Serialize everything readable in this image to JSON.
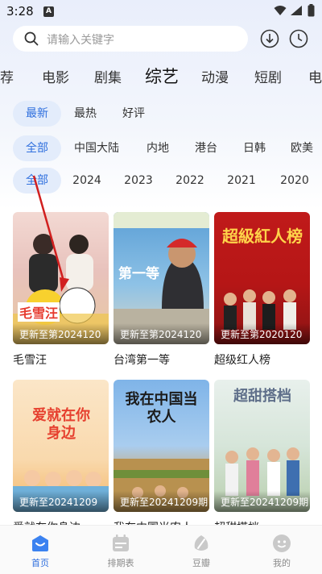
{
  "status_bar": {
    "time": "3:28",
    "badge": "A"
  },
  "search": {
    "placeholder": "请输入关键字"
  },
  "category_tabs": [
    "荐",
    "电影",
    "剧集",
    "综艺",
    "动漫",
    "短剧",
    "电"
  ],
  "active_category": "综艺",
  "filters": {
    "sort": [
      "最新",
      "最热",
      "好评"
    ],
    "region": [
      "全部",
      "中国大陆",
      "内地",
      "港台",
      "日韩",
      "欧美"
    ],
    "year": [
      "全部",
      "2024",
      "2023",
      "2022",
      "2021",
      "2020"
    ]
  },
  "selected_filters": {
    "sort": "最新",
    "region": "全部",
    "year": "全部"
  },
  "shows": [
    {
      "title": "毛雪汪",
      "update": "更新至第2024120",
      "poster_text": "毛雪汪"
    },
    {
      "title": "台湾第一等",
      "update": "更新至第2024120",
      "poster_text": "第一等"
    },
    {
      "title": "超级红人榜",
      "update": "更新至第2020120",
      "poster_text": "超級紅人榜"
    },
    {
      "title": "爱就在你身边",
      "update": "更新至20241209",
      "poster_text": "爱就在你身边"
    },
    {
      "title": "我在中国当农人",
      "update": "更新至20241209期",
      "poster_text": "我在中国当农人"
    },
    {
      "title": "超甜搭档",
      "update": "更新至20241209期",
      "poster_text": "超甜搭档"
    }
  ],
  "bottom_nav": [
    "首页",
    "排期表",
    "豆瓣",
    "我的"
  ],
  "active_nav": "首页",
  "colors": {
    "accent": "#2f6fde",
    "chip_bg": "#e3ecfb"
  }
}
